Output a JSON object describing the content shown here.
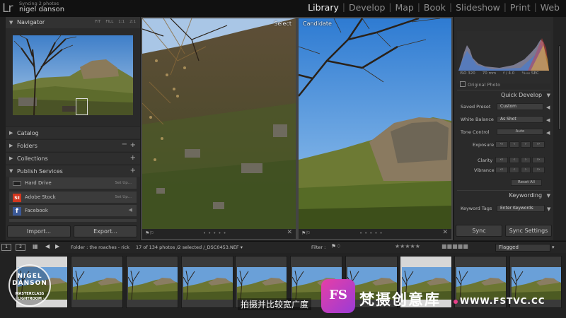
{
  "app": {
    "logo": "Lr",
    "sync_status": "Syncing 2 photos",
    "user_name": "nigel danson"
  },
  "modules": [
    "Library",
    "Develop",
    "Map",
    "Book",
    "Slideshow",
    "Print",
    "Web"
  ],
  "active_module": "Library",
  "left_panel": {
    "navigator": {
      "title": "Navigator",
      "zoom_options": [
        "FIT",
        "FILL",
        "1:1",
        "2:1"
      ]
    },
    "sections": [
      {
        "label": "Catalog",
        "expanded": false
      },
      {
        "label": "Folders",
        "expanded": false
      },
      {
        "label": "Collections",
        "expanded": false
      },
      {
        "label": "Publish Services",
        "expanded": true
      }
    ],
    "publish_services": [
      {
        "name": "Hard Drive",
        "action": "Set Up..."
      },
      {
        "name": "Adobe Stock",
        "action": "Set Up..."
      },
      {
        "name": "Facebook",
        "action": ""
      }
    ],
    "import_label": "Import...",
    "export_label": "Export..."
  },
  "compare": {
    "select_label": "Select",
    "candidate_label": "Candidate"
  },
  "right_panel": {
    "histogram_meta": {
      "iso": "ISO 320",
      "focal": "70 mm",
      "aperture": "f / 4.0",
      "shutter": "¹⁄₁₀₀₀ SEC"
    },
    "original_photo": "Original Photo",
    "quick_develop_title": "Quick Develop",
    "saved_preset_label": "Saved Preset",
    "saved_preset_value": "Custom",
    "white_balance_label": "White Balance",
    "white_balance_value": "As Shot",
    "tone_control_label": "Tone Control",
    "tone_control_button": "Auto",
    "exposure_label": "Exposure",
    "clarity_label": "Clarity",
    "vibrance_label": "Vibrance",
    "reset_all": "Reset All",
    "keywording_title": "Keywording",
    "keyword_tags_label": "Keyword Tags",
    "keyword_tags_value": "Enter Keywords",
    "sync_label": "Sync",
    "sync_settings_label": "Sync Settings"
  },
  "filmstrip_bar": {
    "view1": "1",
    "view2": "2",
    "folder_text": "Folder : the roaches - rick",
    "count_text": "17 of 134 photos /2 selected /_DSC0453.NEF ▾",
    "filter_label": "Filter :",
    "filter_value": "Flagged"
  },
  "watermark": {
    "name": "NIGEL DANSON",
    "line2": "MASTERCLASS",
    "line3": "· LIGHTROOM ·"
  },
  "overlay": {
    "subtitle": "拍摄并比较宽广度",
    "logo_text": "FS",
    "brand": "梵摄创意库",
    "url": "WWW.FSTVC.CC"
  }
}
